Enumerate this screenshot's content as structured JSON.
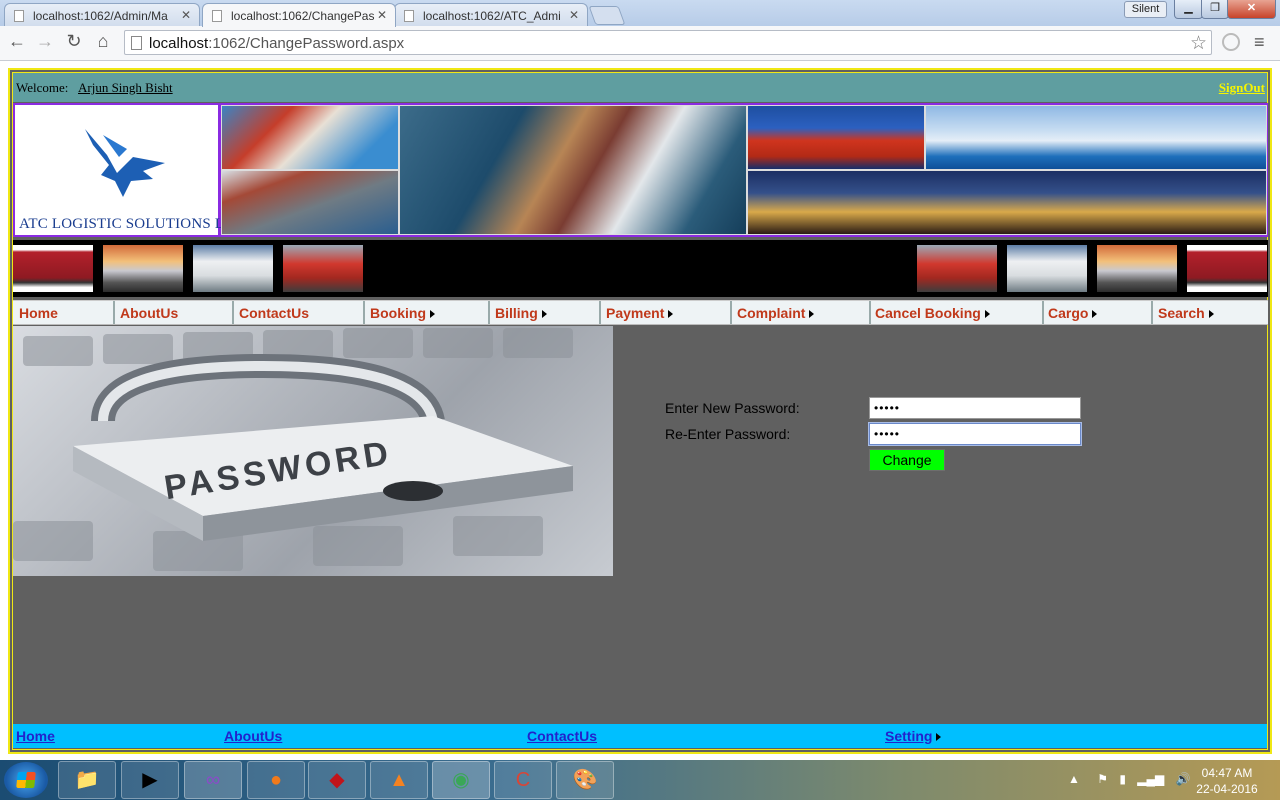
{
  "browser": {
    "tabs": [
      {
        "title": "localhost:1062/Admin/Ma",
        "active": false
      },
      {
        "title": "localhost:1062/ChangePas",
        "active": true
      },
      {
        "title": "localhost:1062/ATC_Admi",
        "active": false
      }
    ],
    "silent_label": "Silent",
    "window_buttons": {
      "minimize": "▁",
      "maximize": "❐",
      "close": "✕"
    },
    "url_host": "localhost",
    "url_path": ":1062/ChangePassword.aspx"
  },
  "header": {
    "welcome_label": "Welcome:",
    "user_name": "Arjun Singh Bisht",
    "signout_label": "SignOut",
    "brand": "ATC LOGISTIC SOLUTIONS LTD."
  },
  "nav": {
    "items": [
      {
        "label": "Home",
        "has_submenu": false
      },
      {
        "label": "AboutUs",
        "has_submenu": false
      },
      {
        "label": "ContactUs",
        "has_submenu": false
      },
      {
        "label": "Booking",
        "has_submenu": true
      },
      {
        "label": "Billing",
        "has_submenu": true
      },
      {
        "label": "Payment",
        "has_submenu": true
      },
      {
        "label": "Complaint",
        "has_submenu": true
      },
      {
        "label": "Cancel Booking",
        "has_submenu": true
      },
      {
        "label": "Cargo",
        "has_submenu": true
      },
      {
        "label": "Search",
        "has_submenu": true
      }
    ]
  },
  "form": {
    "new_password_label": "Enter New Password:",
    "new_password_value": "•••••",
    "reenter_password_label": "Re-Enter Password:",
    "reenter_password_value": "•••••",
    "change_button": "Change"
  },
  "lock_image_text": "PASSWORD",
  "footer": {
    "links": [
      {
        "label": "Home"
      },
      {
        "label": "AboutUs"
      },
      {
        "label": "ContactUs"
      },
      {
        "label": "Setting",
        "has_submenu": true
      }
    ]
  },
  "taskbar": {
    "clock_time": "04:47 AM",
    "clock_date": "22-04-2016"
  },
  "colors": {
    "welcome_bar": "#5f9ea0",
    "signout": "#f5f500",
    "page_background": "#606060",
    "frame_border": "#f0e814",
    "banner_border": "#8a2be2",
    "nav_text": "#c0391b",
    "change_button": "#00ff00",
    "footer": "#00bfff"
  }
}
